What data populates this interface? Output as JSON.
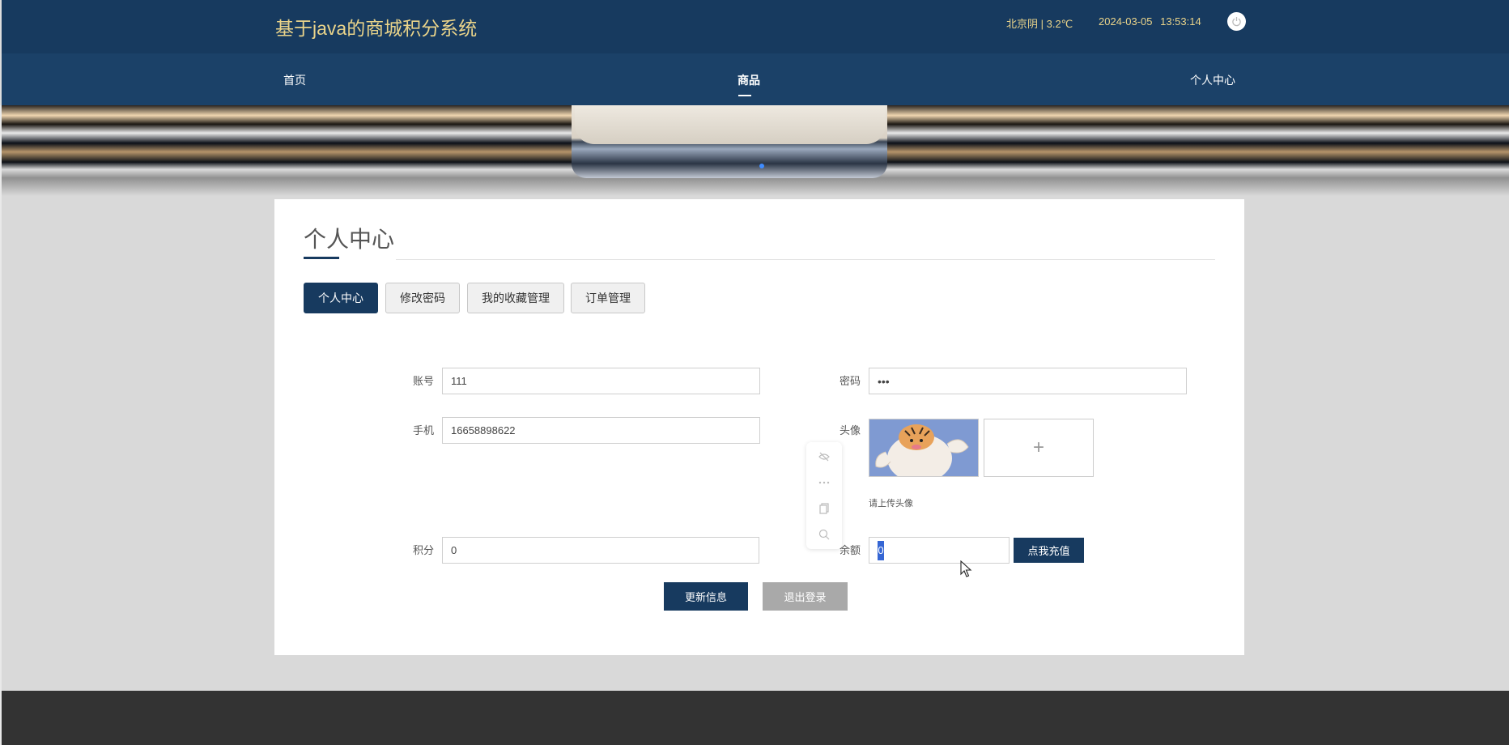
{
  "header": {
    "site_title": "基于java的商城积分系统",
    "weather": "北京阴 | 3.2℃",
    "datetime": "2024-03-05  13:53:14",
    "power_icon": "power-icon"
  },
  "nav": {
    "items": [
      {
        "label": "首页"
      },
      {
        "label": "商品"
      },
      {
        "label": "个人中心"
      }
    ]
  },
  "card": {
    "title": "个人中心",
    "tabs": [
      {
        "label": "个人中心",
        "active": true
      },
      {
        "label": "修改密码",
        "active": false
      },
      {
        "label": "我的收藏管理",
        "active": false
      },
      {
        "label": "订单管理",
        "active": false
      }
    ]
  },
  "form": {
    "account_label": "账号",
    "account_value": "111",
    "password_label": "密码",
    "password_value": "•••",
    "phone_label": "手机",
    "phone_value": "16658898622",
    "avatar_label": "头像",
    "avatar_add_glyph": "+",
    "avatar_hint": "请上传头像",
    "points_label": "积分",
    "points_value": "0",
    "balance_label": "余额",
    "balance_value": "0",
    "recharge_button": "点我充值",
    "update_button": "更新信息",
    "logout_button": "退出登录"
  },
  "colors": {
    "primary": "#173a5f",
    "title_gold": "#ead48a",
    "footer": "#333333"
  }
}
